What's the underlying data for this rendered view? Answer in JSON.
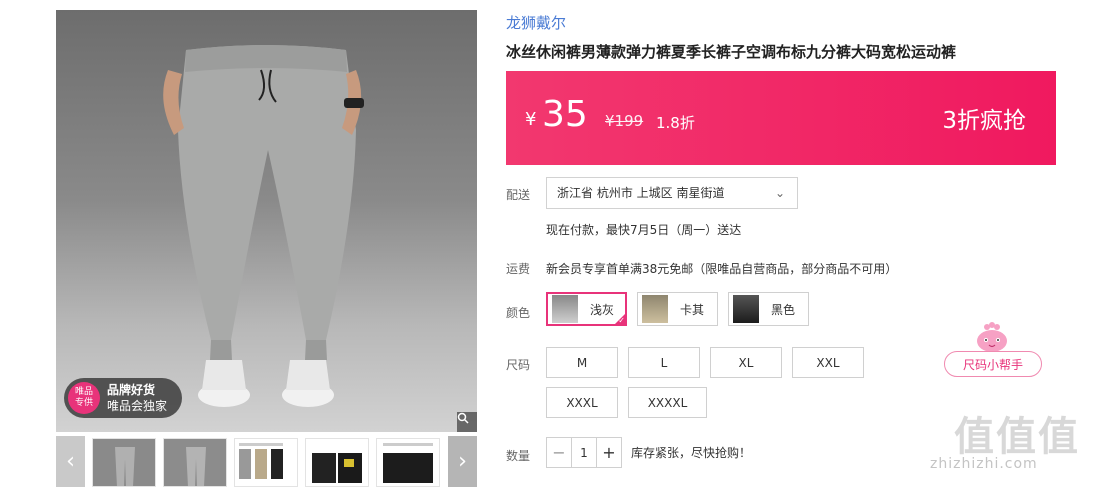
{
  "product": {
    "brand": "龙狮戴尔",
    "title": "冰丝休闲裤男薄款弹力裤夏季长裤子空调布标九分裤大码宽松运动裤"
  },
  "gallery": {
    "badge_logo_line1": "唯品",
    "badge_logo_line2": "专供",
    "badge_line1": "品牌好货",
    "badge_line2": "唯品会独家",
    "zoom_icon": "magnifier-icon",
    "prev_arrow": "‹",
    "next_arrow": "›"
  },
  "price": {
    "currency": "¥",
    "current": "35",
    "original": "¥199",
    "discount": "1.8折",
    "promo": "3折疯抢",
    "bar_color": "#f0195f"
  },
  "delivery": {
    "label": "配送",
    "region": "浙江省 杭州市 上城区 南星街道",
    "estimate": "现在付款，最快7月5日（周一）送达"
  },
  "shipping": {
    "label": "运费",
    "text": "新会员专享首单满38元免邮（限唯品自营商品，部分商品不可用）"
  },
  "colors": {
    "label": "颜色",
    "options": [
      {
        "name": "浅灰",
        "selected": true
      },
      {
        "name": "卡其",
        "selected": false
      },
      {
        "name": "黑色",
        "selected": false
      }
    ],
    "accent": "#e8337a"
  },
  "sizes": {
    "label": "尺码",
    "options": [
      "M",
      "L",
      "XL",
      "XXL",
      "XXXL",
      "XXXXL"
    ]
  },
  "size_helper": {
    "label": "尺码小帮手"
  },
  "quantity": {
    "label": "数量",
    "value": "1",
    "minus": "−",
    "plus": "+",
    "note": "库存紧张，尽快抢购！"
  },
  "watermark": {
    "logo": "值值值",
    "url": "zhizhizhi.com"
  }
}
